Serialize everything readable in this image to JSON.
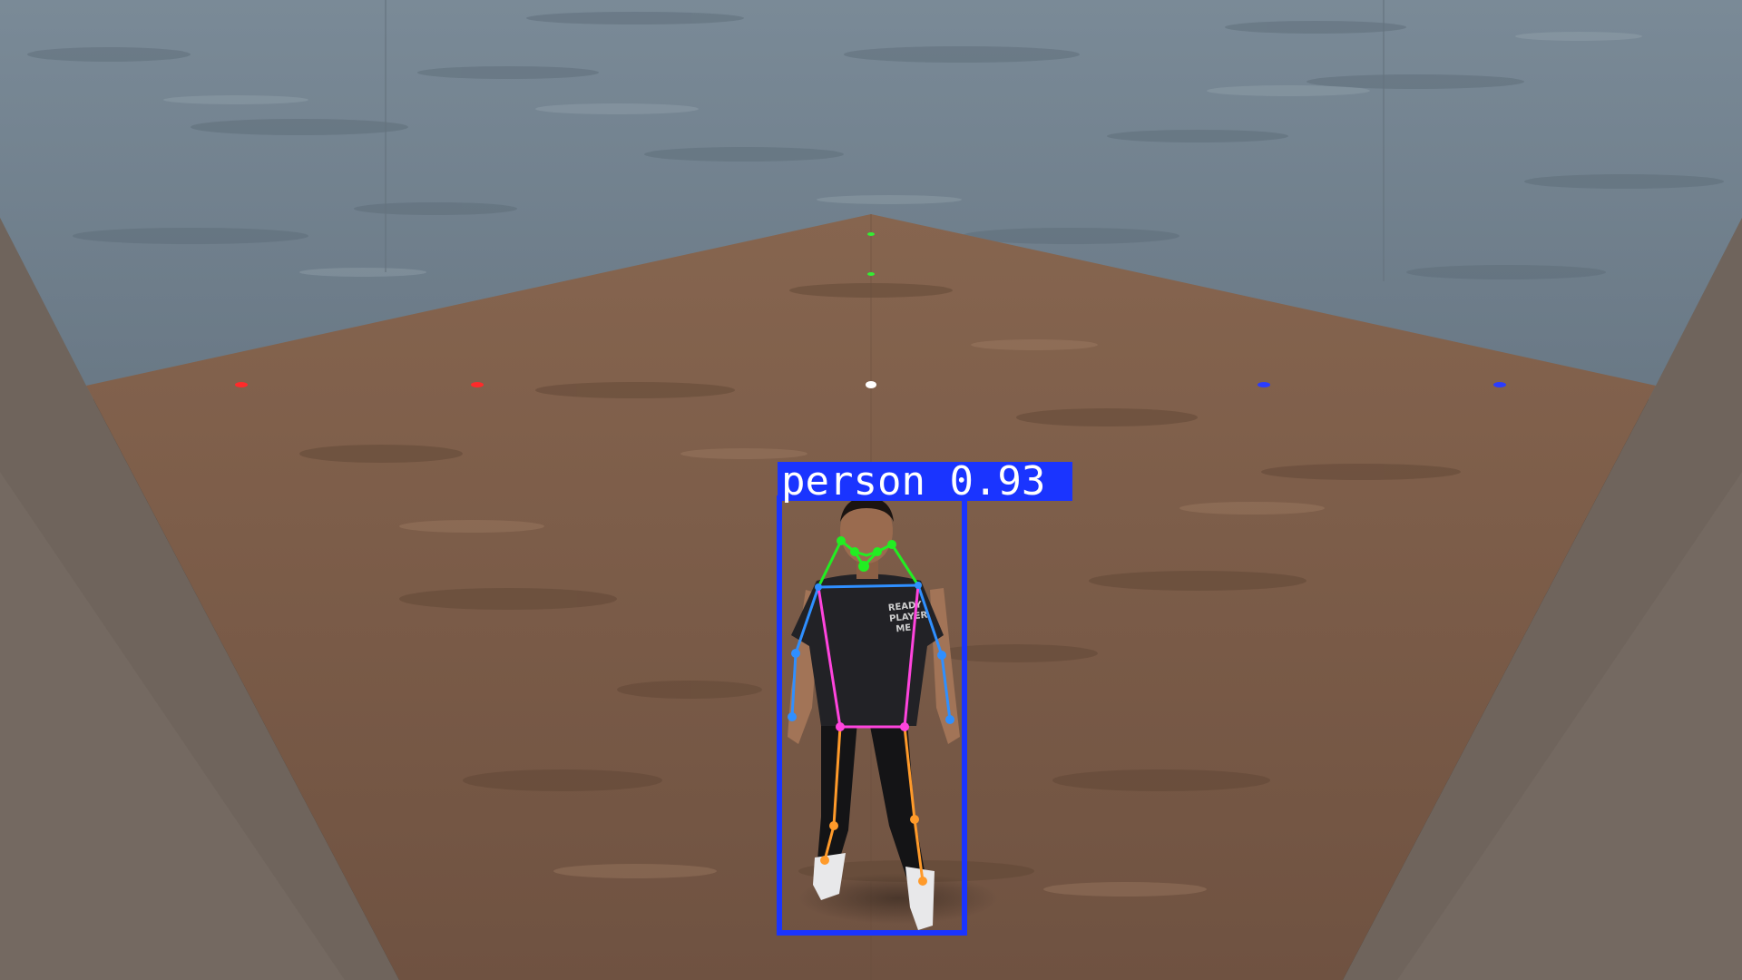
{
  "detection": {
    "class_label": "person",
    "confidence": "0.93",
    "box_color": "#1a34ff",
    "label_text_color": "#ffffff"
  },
  "skeleton_colors": {
    "face": "#22ee22",
    "arms": "#2f8fff",
    "torso": "#ff44dd",
    "legs": "#ff9a2a"
  },
  "floor_markers": {
    "red": "#ff2a2a",
    "green": "#33ee33",
    "white": "#ffffff",
    "blue": "#2a3cff"
  },
  "scene_colors": {
    "wall": "#6f7f8c",
    "floor": "#7a5b47",
    "side_wall": "#746961"
  },
  "avatar": {
    "shirt_text": [
      "READY",
      "PLAYER",
      "ME"
    ]
  }
}
